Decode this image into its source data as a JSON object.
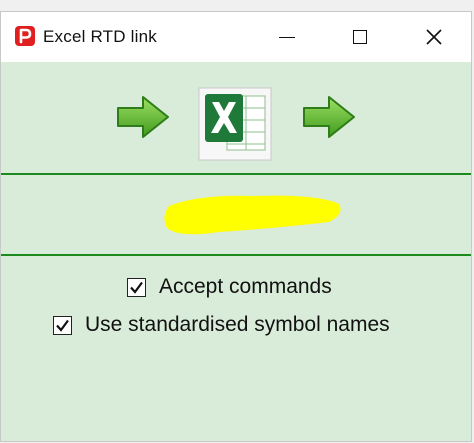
{
  "window": {
    "title": "Excel RTD link",
    "icons": [
      "app-logo-icon",
      "minimize-icon",
      "maximize-icon",
      "close-icon"
    ]
  },
  "header_icons": [
    "arrow-right-icon",
    "excel-icon",
    "arrow-right-icon"
  ],
  "options": [
    {
      "label": "Accept commands",
      "checked": true
    },
    {
      "label": "Use standardised symbol names",
      "checked": true
    }
  ],
  "colors": {
    "panel_background": "#d9ecd9",
    "divider": "#1c8a1c",
    "highlight": "#ffff00",
    "arrow_green": "#5cb82e",
    "excel_green": "#1f7a3a"
  }
}
